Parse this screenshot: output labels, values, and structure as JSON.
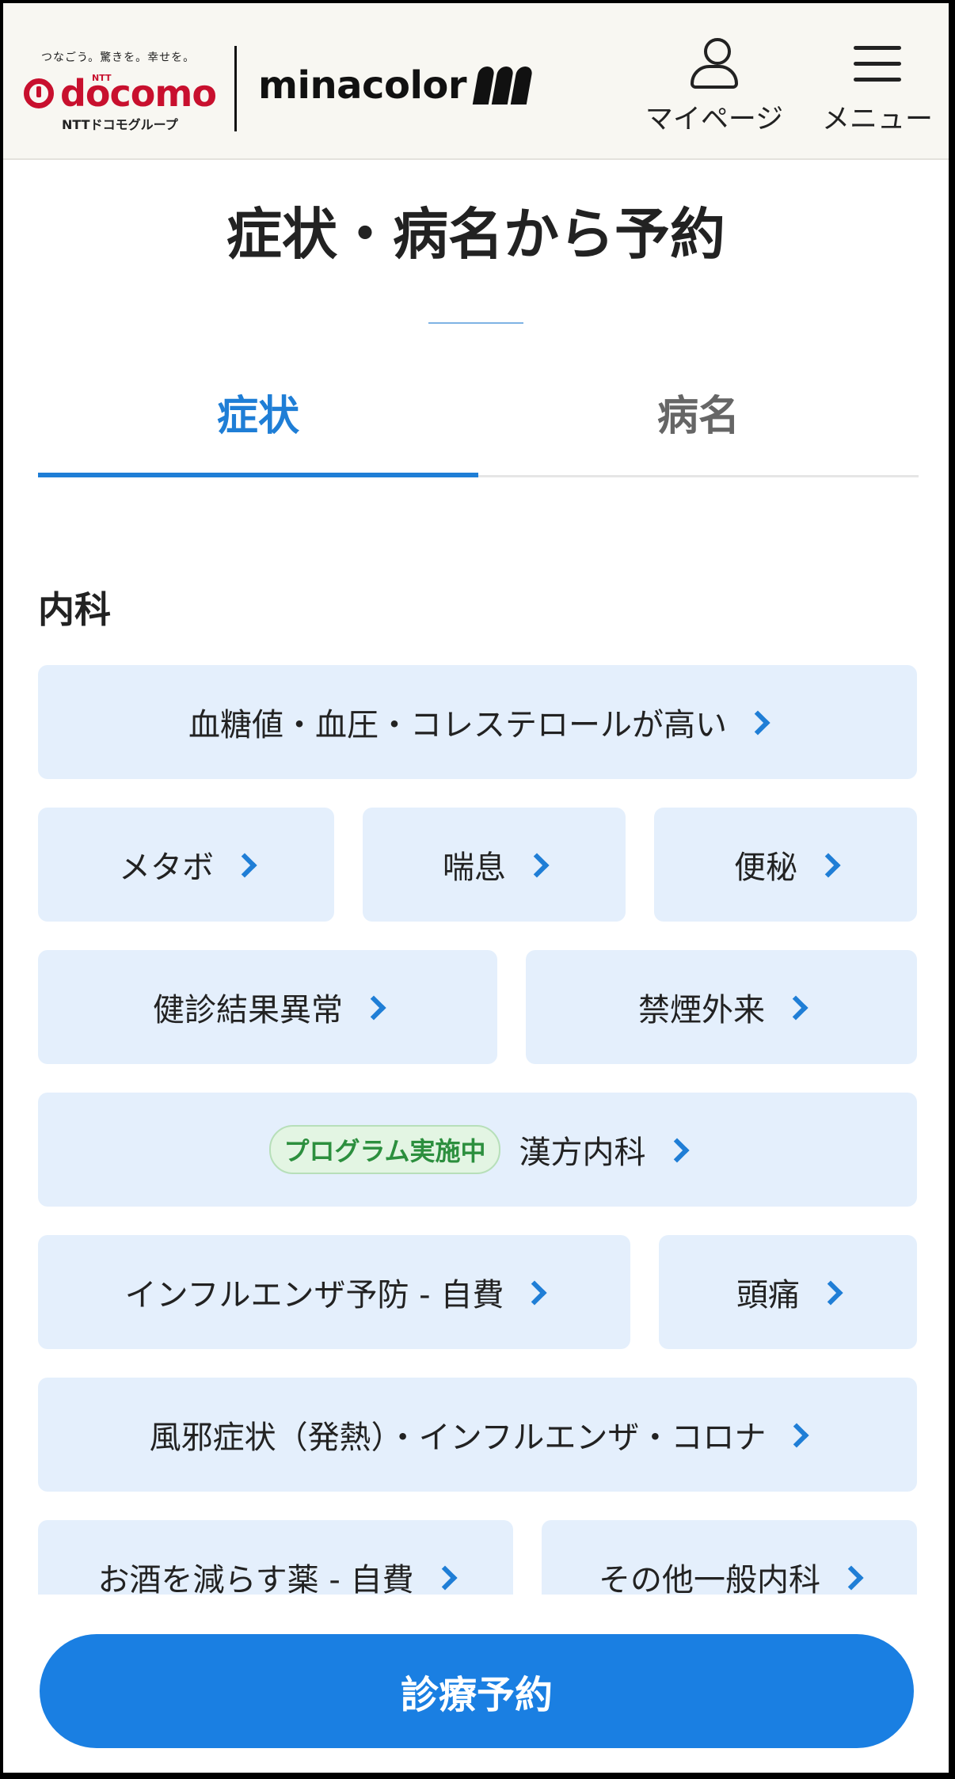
{
  "header": {
    "docomo_tagline": "つなごう。驚きを。幸せを。",
    "docomo_ntt": "NTT",
    "docomo_brand": "docomo",
    "docomo_group": "NTTドコモグループ",
    "service_brand": "minacolor",
    "mypage_label": "マイページ",
    "menu_label": "メニュー"
  },
  "page": {
    "title": "症状・病名から予約"
  },
  "tabs": [
    {
      "label": "症状",
      "active": true
    },
    {
      "label": "病名",
      "active": false
    }
  ],
  "section": {
    "title": "内科",
    "items": [
      {
        "label": "血糖値・血圧・コレステロールが高い"
      },
      {
        "label": "メタボ"
      },
      {
        "label": "喘息"
      },
      {
        "label": "便秘"
      },
      {
        "label": "健診結果異常"
      },
      {
        "label": "禁煙外来"
      },
      {
        "label": "漢方内科",
        "badge": "プログラム実施中"
      },
      {
        "label": "インフルエンザ予防 - 自費"
      },
      {
        "label": "頭痛"
      },
      {
        "label": "風邪症状（発熱）・インフルエンザ・コロナ"
      },
      {
        "label": "お酒を減らす薬 - 自費"
      },
      {
        "label": "その他一般内科"
      }
    ]
  },
  "cta": {
    "label": "診療予約"
  },
  "colors": {
    "accent": "#1f7ed6",
    "chip_bg": "#e4effc",
    "badge_green": "#2c8f3e",
    "docomo_red": "#c8102e"
  }
}
